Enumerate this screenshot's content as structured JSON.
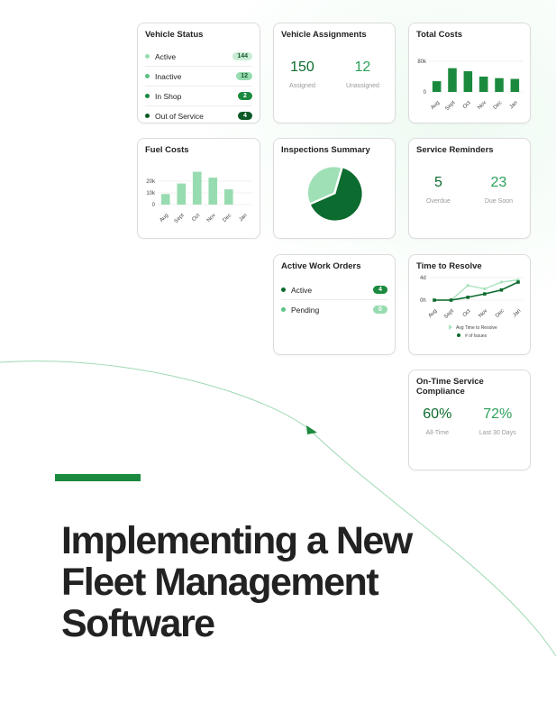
{
  "colors": {
    "dark_green": "#0c6b2e",
    "mid_green": "#2ca05a",
    "light_green": "#97dcb0",
    "pale_green": "#c7edd4"
  },
  "vehicle_status": {
    "title": "Vehicle Status",
    "items": [
      {
        "label": "Active",
        "count": "144"
      },
      {
        "label": "Inactive",
        "count": "12"
      },
      {
        "label": "In Shop",
        "count": "2"
      },
      {
        "label": "Out of Service",
        "count": "4"
      }
    ]
  },
  "vehicle_assignments": {
    "title": "Vehicle Assignments",
    "assigned_value": "150",
    "assigned_label": "Assigned",
    "unassigned_value": "12",
    "unassigned_label": "Unassigned"
  },
  "service_reminders": {
    "title": "Service Reminders",
    "overdue_value": "5",
    "overdue_label": "Overdue",
    "due_soon_value": "23",
    "due_soon_label": "Due Soon"
  },
  "inspections": {
    "title": "Inspections Summary"
  },
  "work_orders": {
    "title": "Active Work Orders",
    "items": [
      {
        "label": "Active",
        "count": "4"
      },
      {
        "label": "Pending",
        "count": "0"
      }
    ]
  },
  "compliance": {
    "title": "On-Time Service Compliance",
    "all_time_value": "60%",
    "all_time_label": "All-Time",
    "last30_value": "72%",
    "last30_label": "Last 30 Days"
  },
  "hero": {
    "line1": "Implementing a New",
    "line2": "Fleet Management",
    "line3": "Software"
  },
  "chart_data": [
    {
      "id": "total_costs",
      "type": "bar",
      "title": "Total Costs",
      "categories": [
        "Aug",
        "Sept",
        "Oct",
        "Nov",
        "Dec",
        "Jan"
      ],
      "values": [
        28,
        62,
        54,
        40,
        36,
        34
      ],
      "yticks": [
        "0",
        "80k"
      ],
      "ylim": [
        0,
        80
      ]
    },
    {
      "id": "fuel_costs",
      "type": "bar",
      "title": "Fuel Costs",
      "categories": [
        "Aug",
        "Sept",
        "Oct",
        "Nov",
        "Dec",
        "Jan"
      ],
      "values": [
        9,
        18,
        28,
        23,
        13,
        0
      ],
      "yticks": [
        "0",
        "10k",
        "20k"
      ],
      "ylim": [
        0,
        20
      ]
    },
    {
      "id": "inspections_summary",
      "type": "pie",
      "title": "Inspections Summary",
      "values": [
        64,
        36
      ]
    },
    {
      "id": "time_to_resolve",
      "type": "line",
      "title": "Time to Resolve",
      "categories": [
        "Aug",
        "Sept",
        "Oct",
        "Nov",
        "Dec",
        "Jan"
      ],
      "yticks": [
        "0h",
        "4d"
      ],
      "series": [
        {
          "name": "Avg Time to Resolve",
          "values": [
            0,
            0,
            2.6,
            2.0,
            3.2,
            3.6
          ]
        },
        {
          "name": "# of Issues",
          "values": [
            0,
            0,
            0.5,
            1.1,
            1.8,
            3.2
          ]
        }
      ],
      "ylim": [
        0,
        4
      ]
    }
  ]
}
